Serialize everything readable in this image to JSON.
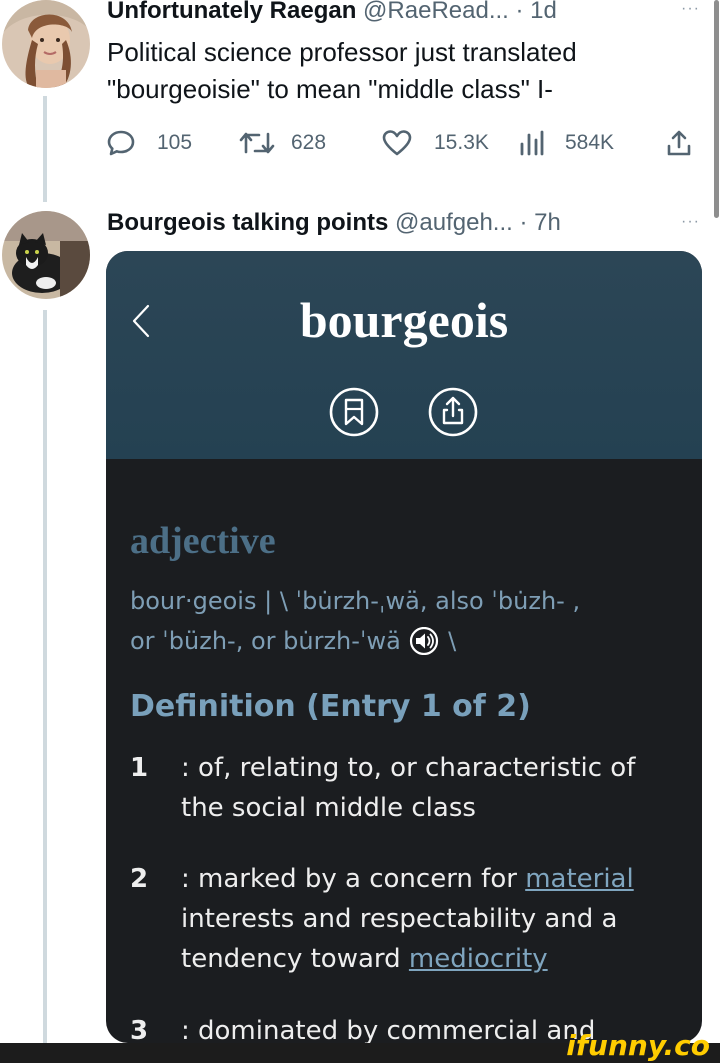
{
  "tweets": [
    {
      "display_name": "Unfortunately Raegan",
      "handle": "@RaeRead...",
      "separator": "·",
      "time": "1d",
      "text_line1": "Political science professor just translated",
      "text_line2": "\"bourgeoisie\" to mean \"middle class\" I-",
      "stats": {
        "replies": "105",
        "retweets": "628",
        "likes": "15.3K",
        "views": "584K"
      }
    },
    {
      "display_name": "Bourgeois talking points",
      "handle": "@aufgeh...",
      "separator": "·",
      "time": "7h"
    }
  ],
  "more_glyph": "···",
  "dictionary": {
    "headword": "bourgeois",
    "part_of_speech": "adjective",
    "pron_line1": "bour·geois  |  \\ ˈbu̇rzh-ˌwä, also ˈbu̇zh- ,",
    "pron_line2": "or ˈbüzh-, or bu̇rzh-ˈwä",
    "pron_end": "\\",
    "definition_heading": "Definition (Entry 1 of 2)",
    "senses": [
      {
        "num": "1",
        "text": ": of, relating to, or characteristic of the social middle class"
      },
      {
        "num": "2",
        "text_before": ": marked by a concern for ",
        "link1": "material",
        "text_mid": " interests and respectability and a tendency toward ",
        "link2": "mediocrity"
      },
      {
        "num": "3",
        "text": ": dominated by commercial and"
      }
    ]
  },
  "watermark": "ifunny.co",
  "colors": {
    "dict_header_bg": "#2c4656",
    "dict_body_bg": "#1b1d20",
    "part_of_speech": "#4c6f87",
    "link": "#7fa5bf",
    "watermark": "#ffcc00"
  }
}
